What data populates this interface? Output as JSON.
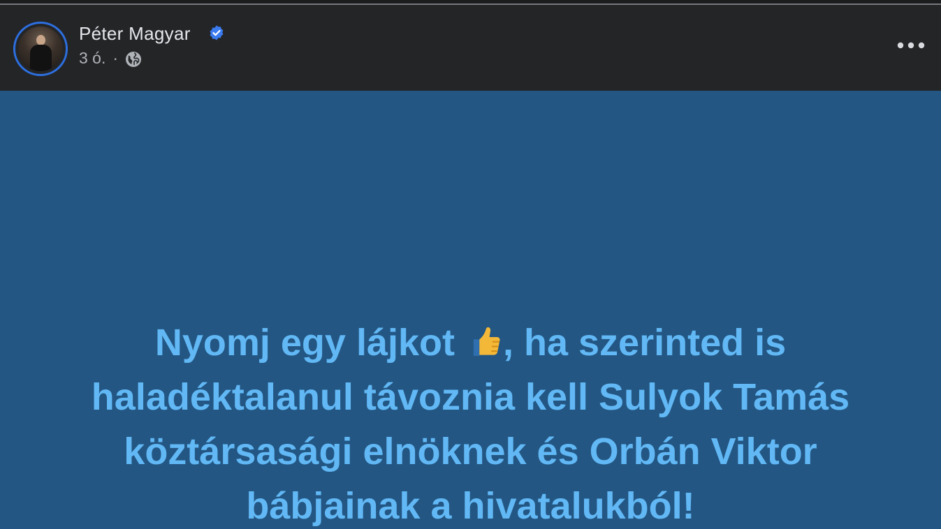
{
  "post": {
    "author_name": "Péter Magyar",
    "timestamp": "3 ó.",
    "separator": "·",
    "privacy_icon": "globe-icon",
    "verified_icon": "verified-badge-icon",
    "more_icon": "more-options-icon",
    "background_color": "#235683",
    "text_color": "#61b8f5",
    "text_lines": [
      "Nyomj egy lájkot ",
      ", ha szerinted is",
      "haladéktalanul távoznia kell Sulyok Tamás",
      "köztársasági elnöknek és Orbán Viktor",
      "bábjainak a hivatalukból!"
    ],
    "emoji": "thumbs-up-icon"
  },
  "colors": {
    "header_bg": "#242527",
    "avatar_ring": "#2d6fe0",
    "verified": "#3b7bf0",
    "name_text": "#e4e6eb",
    "meta_text": "#b0b3b8"
  }
}
